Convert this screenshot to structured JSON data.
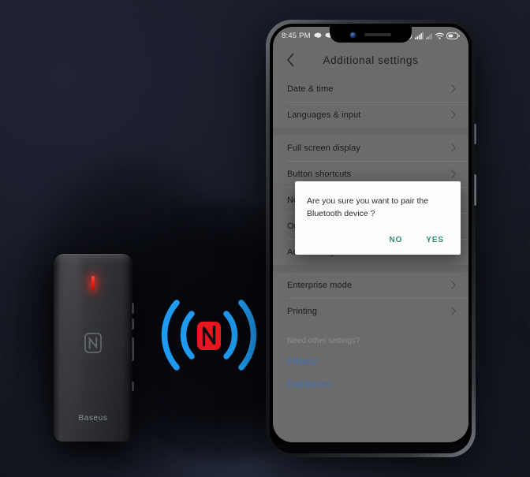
{
  "scene": {
    "background_color": "#1b1e2b",
    "accent_blue": "#1e9bf0",
    "nfc_red": "#e8161f",
    "led_red": "#f01b10"
  },
  "device": {
    "brand": "Baseus",
    "led_name": "red-power-led",
    "nfc_mark_name": "nfc-logo"
  },
  "nfc_emblem": {
    "name": "nfc-wave-emblem",
    "logo_color": "#e8161f",
    "wave_color": "#1e9bf0"
  },
  "phone": {
    "statusbar": {
      "time": "8:45 PM",
      "left_icons": [
        "message-cloud-icon",
        "message-cloud-icon"
      ],
      "right_icons": [
        "bluetooth-icon",
        "alarm-icon",
        "signal-bars-icon",
        "signal-bars-secondary-icon",
        "wifi-icon",
        "battery-icon"
      ]
    },
    "appbar": {
      "back_label": "‹",
      "title": "Additional  settings"
    },
    "settings_groups": [
      {
        "items": [
          {
            "label": "Date & time"
          },
          {
            "label": "Languages & input"
          }
        ]
      },
      {
        "items": [
          {
            "label": "Full screen display"
          },
          {
            "label": "Button shortcuts"
          },
          {
            "label": "Notification light"
          },
          {
            "label": "One-handed mode"
          },
          {
            "label": "Accessibility"
          }
        ]
      },
      {
        "items": [
          {
            "label": "Enterprise mode"
          },
          {
            "label": "Printing"
          }
        ]
      }
    ],
    "footer": {
      "hint": "Need other settings?",
      "links": [
        {
          "label": "Privacy"
        },
        {
          "label": "Earphones"
        }
      ]
    },
    "dialog": {
      "message": "Are you sure you want to pair the Bluetooth device ?",
      "negative_label": "NO",
      "positive_label": "YES",
      "button_color": "#2f8a78"
    }
  }
}
